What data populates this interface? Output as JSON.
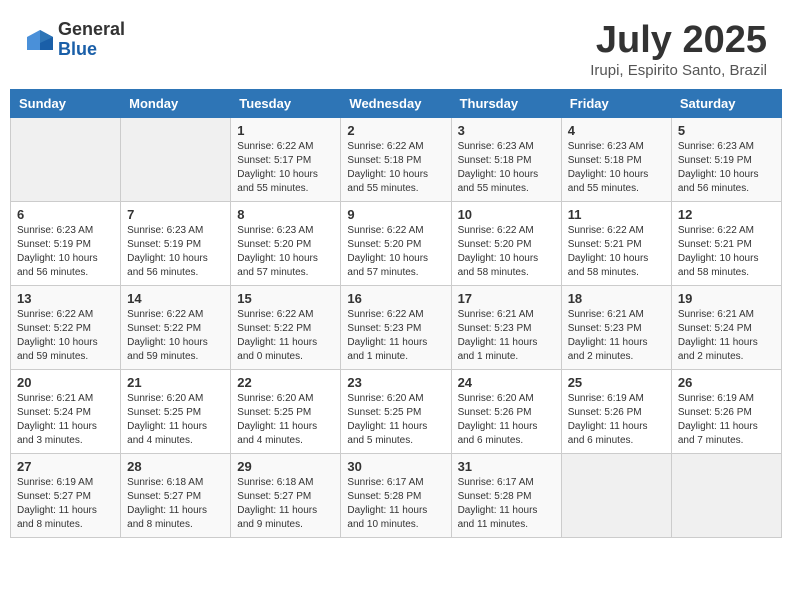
{
  "logo": {
    "general": "General",
    "blue": "Blue"
  },
  "header": {
    "month": "July 2025",
    "location": "Irupi, Espirito Santo, Brazil"
  },
  "weekdays": [
    "Sunday",
    "Monday",
    "Tuesday",
    "Wednesday",
    "Thursday",
    "Friday",
    "Saturday"
  ],
  "weeks": [
    [
      {
        "day": "",
        "info": ""
      },
      {
        "day": "",
        "info": ""
      },
      {
        "day": "1",
        "info": "Sunrise: 6:22 AM\nSunset: 5:17 PM\nDaylight: 10 hours and 55 minutes."
      },
      {
        "day": "2",
        "info": "Sunrise: 6:22 AM\nSunset: 5:18 PM\nDaylight: 10 hours and 55 minutes."
      },
      {
        "day": "3",
        "info": "Sunrise: 6:23 AM\nSunset: 5:18 PM\nDaylight: 10 hours and 55 minutes."
      },
      {
        "day": "4",
        "info": "Sunrise: 6:23 AM\nSunset: 5:18 PM\nDaylight: 10 hours and 55 minutes."
      },
      {
        "day": "5",
        "info": "Sunrise: 6:23 AM\nSunset: 5:19 PM\nDaylight: 10 hours and 56 minutes."
      }
    ],
    [
      {
        "day": "6",
        "info": "Sunrise: 6:23 AM\nSunset: 5:19 PM\nDaylight: 10 hours and 56 minutes."
      },
      {
        "day": "7",
        "info": "Sunrise: 6:23 AM\nSunset: 5:19 PM\nDaylight: 10 hours and 56 minutes."
      },
      {
        "day": "8",
        "info": "Sunrise: 6:23 AM\nSunset: 5:20 PM\nDaylight: 10 hours and 57 minutes."
      },
      {
        "day": "9",
        "info": "Sunrise: 6:22 AM\nSunset: 5:20 PM\nDaylight: 10 hours and 57 minutes."
      },
      {
        "day": "10",
        "info": "Sunrise: 6:22 AM\nSunset: 5:20 PM\nDaylight: 10 hours and 58 minutes."
      },
      {
        "day": "11",
        "info": "Sunrise: 6:22 AM\nSunset: 5:21 PM\nDaylight: 10 hours and 58 minutes."
      },
      {
        "day": "12",
        "info": "Sunrise: 6:22 AM\nSunset: 5:21 PM\nDaylight: 10 hours and 58 minutes."
      }
    ],
    [
      {
        "day": "13",
        "info": "Sunrise: 6:22 AM\nSunset: 5:22 PM\nDaylight: 10 hours and 59 minutes."
      },
      {
        "day": "14",
        "info": "Sunrise: 6:22 AM\nSunset: 5:22 PM\nDaylight: 10 hours and 59 minutes."
      },
      {
        "day": "15",
        "info": "Sunrise: 6:22 AM\nSunset: 5:22 PM\nDaylight: 11 hours and 0 minutes."
      },
      {
        "day": "16",
        "info": "Sunrise: 6:22 AM\nSunset: 5:23 PM\nDaylight: 11 hours and 1 minute."
      },
      {
        "day": "17",
        "info": "Sunrise: 6:21 AM\nSunset: 5:23 PM\nDaylight: 11 hours and 1 minute."
      },
      {
        "day": "18",
        "info": "Sunrise: 6:21 AM\nSunset: 5:23 PM\nDaylight: 11 hours and 2 minutes."
      },
      {
        "day": "19",
        "info": "Sunrise: 6:21 AM\nSunset: 5:24 PM\nDaylight: 11 hours and 2 minutes."
      }
    ],
    [
      {
        "day": "20",
        "info": "Sunrise: 6:21 AM\nSunset: 5:24 PM\nDaylight: 11 hours and 3 minutes."
      },
      {
        "day": "21",
        "info": "Sunrise: 6:20 AM\nSunset: 5:25 PM\nDaylight: 11 hours and 4 minutes."
      },
      {
        "day": "22",
        "info": "Sunrise: 6:20 AM\nSunset: 5:25 PM\nDaylight: 11 hours and 4 minutes."
      },
      {
        "day": "23",
        "info": "Sunrise: 6:20 AM\nSunset: 5:25 PM\nDaylight: 11 hours and 5 minutes."
      },
      {
        "day": "24",
        "info": "Sunrise: 6:20 AM\nSunset: 5:26 PM\nDaylight: 11 hours and 6 minutes."
      },
      {
        "day": "25",
        "info": "Sunrise: 6:19 AM\nSunset: 5:26 PM\nDaylight: 11 hours and 6 minutes."
      },
      {
        "day": "26",
        "info": "Sunrise: 6:19 AM\nSunset: 5:26 PM\nDaylight: 11 hours and 7 minutes."
      }
    ],
    [
      {
        "day": "27",
        "info": "Sunrise: 6:19 AM\nSunset: 5:27 PM\nDaylight: 11 hours and 8 minutes."
      },
      {
        "day": "28",
        "info": "Sunrise: 6:18 AM\nSunset: 5:27 PM\nDaylight: 11 hours and 8 minutes."
      },
      {
        "day": "29",
        "info": "Sunrise: 6:18 AM\nSunset: 5:27 PM\nDaylight: 11 hours and 9 minutes."
      },
      {
        "day": "30",
        "info": "Sunrise: 6:17 AM\nSunset: 5:28 PM\nDaylight: 11 hours and 10 minutes."
      },
      {
        "day": "31",
        "info": "Sunrise: 6:17 AM\nSunset: 5:28 PM\nDaylight: 11 hours and 11 minutes."
      },
      {
        "day": "",
        "info": ""
      },
      {
        "day": "",
        "info": ""
      }
    ]
  ]
}
